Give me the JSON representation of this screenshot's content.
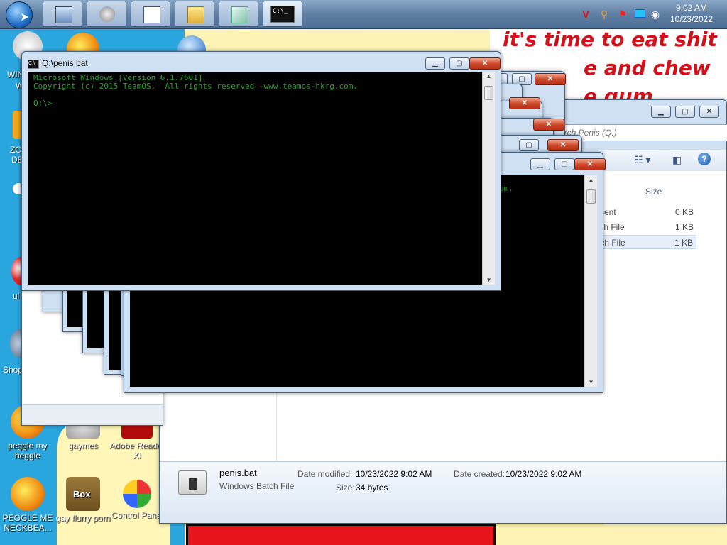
{
  "wallpaper": {
    "lines": [
      "it's time to eat shit",
      "e and chew",
      "e gum"
    ]
  },
  "taskbar": {
    "clock_time": "9:02 AM",
    "clock_date": "10/23/2022",
    "buttons": [
      {
        "icon": "network-computer-icon"
      },
      {
        "icon": "media-player-icon"
      },
      {
        "icon": "notepad-icon"
      },
      {
        "icon": "folder-icon"
      },
      {
        "icon": "document-icon"
      },
      {
        "icon": "command-prompt-icon",
        "label": "C:\\_"
      }
    ],
    "tray": [
      "v-icon",
      "search-tray-icon",
      "flag-icon",
      "monitor-icon",
      "record-icon"
    ]
  },
  "desktop_icons": [
    {
      "label": "peggle my heggle",
      "icon": "peggle-icon"
    },
    {
      "label": "gaymes",
      "icon": "games-icon"
    },
    {
      "label": "Adobe Reader XI",
      "icon": "adobe-reader-icon"
    },
    {
      "label": "PEGGLE ME NECKBEA...",
      "icon": "peggle-icon"
    },
    {
      "label": "gay flurry porn",
      "icon": "box-icon",
      "badge": "Box"
    },
    {
      "label": "Control Panel",
      "icon": "control-panel-icon"
    }
  ],
  "desktop_partial_labels": [
    "WIN",
    "W",
    "ZO",
    "DE",
    "ul",
    "Shop"
  ],
  "cmd_main": {
    "title": "Q:\\penis.bat",
    "lines": [
      "Microsoft Windows [Version 6.1.7601]",
      "Copyright (c) 2015 TeamOS.  All rights reserved -www.teamos-hkrg.com.",
      "",
      "Q:\\>"
    ]
  },
  "cmd_behind": {
    "visible_text": "om."
  },
  "explorer": {
    "search_placeholder": "arch Penis (Q:)",
    "column_size": "Size",
    "rows": [
      {
        "type": "ment",
        "size": "0 KB"
      },
      {
        "type": "tch File",
        "size": "1 KB"
      },
      {
        "type": "tch File",
        "size": "1 KB",
        "selected": true
      }
    ],
    "details": {
      "name": "penis.bat",
      "type": "Windows Batch File",
      "modified_label": "Date modified:",
      "modified_value": "10/23/2022 9:02 AM",
      "created_label": "Date created:",
      "created_value": "10/23/2022 9:02 AM",
      "size_label": "Size:",
      "size_value": "34 bytes"
    }
  }
}
